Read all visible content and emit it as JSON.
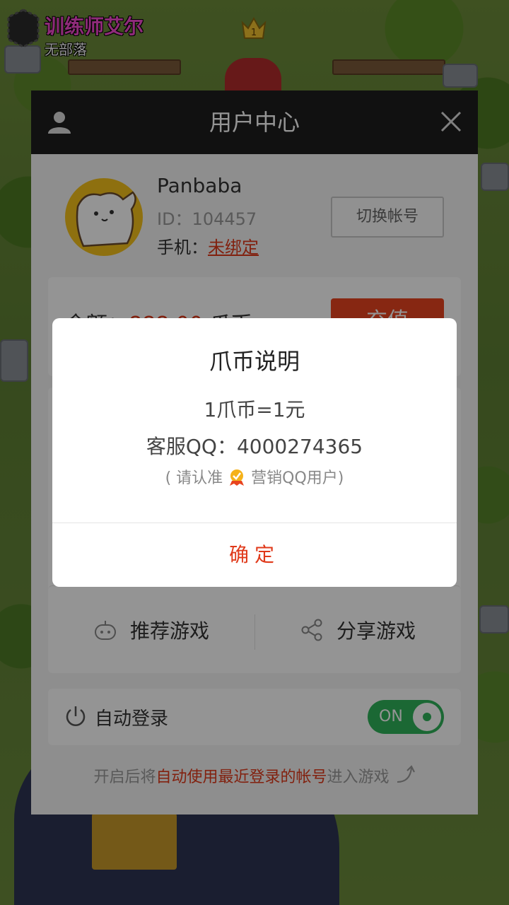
{
  "game": {
    "player_name": "训练师艾尔",
    "clan": "无部落",
    "crown_level": "1"
  },
  "panel": {
    "title": "用户中心",
    "user": {
      "username": "Panbaba",
      "id_text": "ID：104457",
      "phone_label": "手机：",
      "phone_value": "未绑定"
    },
    "switch_account": "切换帐号",
    "balance": {
      "label": "余额：",
      "value": "888.00",
      "unit": "爪币",
      "recharge": "充值"
    },
    "games": {
      "recommend": "推荐游戏",
      "share": "分享游戏"
    },
    "auto_login": {
      "label": "自动登录",
      "toggle": "ON",
      "enabled": true
    },
    "hint": {
      "prefix": "开启后将",
      "emphasis": "自动使用最近登录的帐号",
      "suffix": "进入游戏"
    }
  },
  "dialog": {
    "title": "爪币说明",
    "rate": "1爪币=1元",
    "support_qq": "客服QQ：4000274365",
    "note_prefix": "( 请认准",
    "note_suffix": "营销QQ用户)",
    "confirm": "确定"
  },
  "colors": {
    "accent": "#e0391a",
    "toggle_on": "#2fb35a",
    "header_bg": "#1e1e1e"
  }
}
